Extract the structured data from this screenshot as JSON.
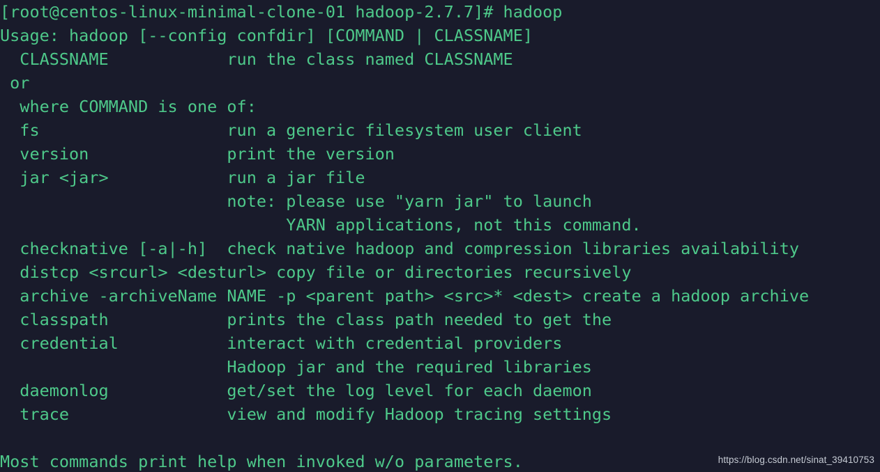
{
  "terminal": {
    "shell_prompt": "[root@centos-linux-minimal-clone-01 hadoop-2.7.7]#",
    "command_entered": "hadoop",
    "colors": {
      "background": "#191b2b",
      "foreground": "#4ec98a",
      "watermark": "#c5cad3"
    },
    "lines": [
      "[root@centos-linux-minimal-clone-01 hadoop-2.7.7]# hadoop",
      "Usage: hadoop [--config confdir] [COMMAND | CLASSNAME]",
      "  CLASSNAME            run the class named CLASSNAME",
      " or",
      "  where COMMAND is one of:",
      "  fs                   run a generic filesystem user client",
      "  version              print the version",
      "  jar <jar>            run a jar file",
      "                       note: please use \"yarn jar\" to launch",
      "                             YARN applications, not this command.",
      "  checknative [-a|-h]  check native hadoop and compression libraries availability",
      "  distcp <srcurl> <desturl> copy file or directories recursively",
      "  archive -archiveName NAME -p <parent path> <src>* <dest> create a hadoop archive",
      "  classpath            prints the class path needed to get the",
      "  credential           interact with credential providers",
      "                       Hadoop jar and the required libraries",
      "  daemonlog            get/set the log level for each daemon",
      "  trace                view and modify Hadoop tracing settings",
      "",
      "Most commands print help when invoked w/o parameters."
    ],
    "commands": [
      {
        "name": "CLASSNAME",
        "description": "run the class named CLASSNAME"
      },
      {
        "name": "fs",
        "description": "run a generic filesystem user client"
      },
      {
        "name": "version",
        "description": "print the version"
      },
      {
        "name": "jar <jar>",
        "description": "run a jar file"
      },
      {
        "name": "checknative [-a|-h]",
        "description": "check native hadoop and compression libraries availability"
      },
      {
        "name": "distcp <srcurl> <desturl>",
        "description": "copy file or directories recursively"
      },
      {
        "name": "archive -archiveName NAME -p <parent path> <src>* <dest>",
        "description": "create a hadoop archive"
      },
      {
        "name": "classpath",
        "description": "prints the class path needed to get the Hadoop jar and the required libraries"
      },
      {
        "name": "credential",
        "description": "interact with credential providers"
      },
      {
        "name": "daemonlog",
        "description": "get/set the log level for each daemon"
      },
      {
        "name": "trace",
        "description": "view and modify Hadoop tracing settings"
      }
    ],
    "footer_note": "Most commands print help when invoked w/o parameters."
  },
  "watermark": {
    "text": "https://blog.csdn.net/sinat_39410753"
  }
}
